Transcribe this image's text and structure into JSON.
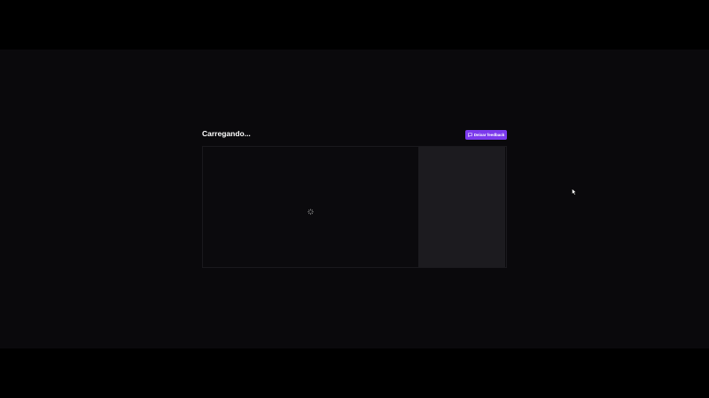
{
  "page": {
    "title": "Carregando..."
  },
  "header": {
    "feedback_button_label": "Deixar feedback",
    "feedback_icon": "message-square-icon"
  },
  "content": {
    "loading_icon": "loader-icon"
  },
  "colors": {
    "accent": "#7c3aed",
    "background": "#0a090c",
    "side_panel": "#1c1b1f",
    "letterbox": "#000000"
  }
}
